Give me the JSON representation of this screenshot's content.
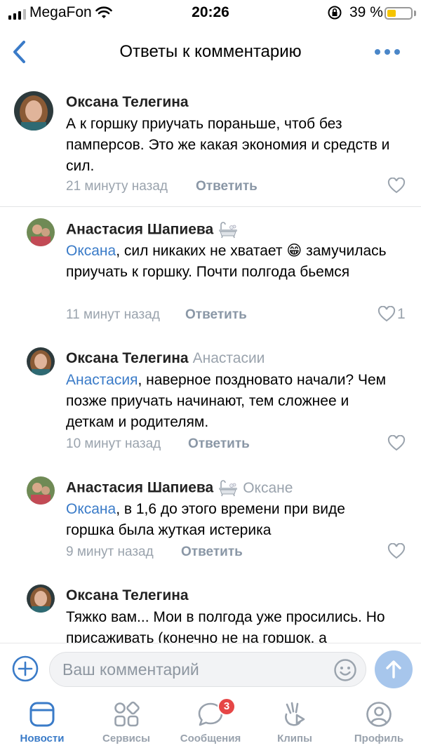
{
  "status_bar": {
    "carrier": "MegaFon",
    "time": "20:26",
    "battery": "39 %"
  },
  "header": {
    "title": "Ответы к комментарию"
  },
  "comments": [
    {
      "author": "Оксана Телегина",
      "text": "А к горшку приучать пораньше, чтоб без памперсов. Это же какая экономия и средств и сил.",
      "time": "21 минуту назад",
      "reply_label": "Ответить"
    },
    {
      "author": "Анастасия Шапиева",
      "mention": "Оксана",
      "text": ", сил никаких не хватает 😁 замучилась приучать к горшку. Почти полгода бьемся",
      "time": "11 минут назад",
      "reply_label": "Ответить",
      "likes": "1"
    },
    {
      "author": "Оксана Телегина",
      "reply_to": "Анастасии",
      "mention": "Анастасия",
      "text": ",  наверное поздновато начали? Чем позже приучать начинают, тем сложнее и деткам и родителям.",
      "time": "10 минут назад",
      "reply_label": "Ответить"
    },
    {
      "author": "Анастасия Шапиева",
      "reply_to": "Оксане",
      "mention": "Оксана",
      "text": ", в 1,6 до этого времени при виде горшка была жуткая истерика",
      "time": "9 минут назад",
      "reply_label": "Ответить"
    },
    {
      "author": "Оксана Телегина",
      "text": "Тяжко вам... Мои в полгода уже просились. Но присаживать (конечно не на горшок, а"
    }
  ],
  "input": {
    "placeholder": "Ваш комментарий"
  },
  "tabs": [
    {
      "label": "Новости",
      "icon": "news-icon",
      "active": true
    },
    {
      "label": "Сервисы",
      "icon": "services-icon"
    },
    {
      "label": "Сообщения",
      "icon": "messages-icon",
      "badge": "3"
    },
    {
      "label": "Клипы",
      "icon": "clips-icon"
    },
    {
      "label": "Профиль",
      "icon": "profile-icon"
    }
  ],
  "colors": {
    "accent": "#3a7bc8",
    "secondary_text": "#9aa3ad",
    "badge": "#e64646"
  }
}
